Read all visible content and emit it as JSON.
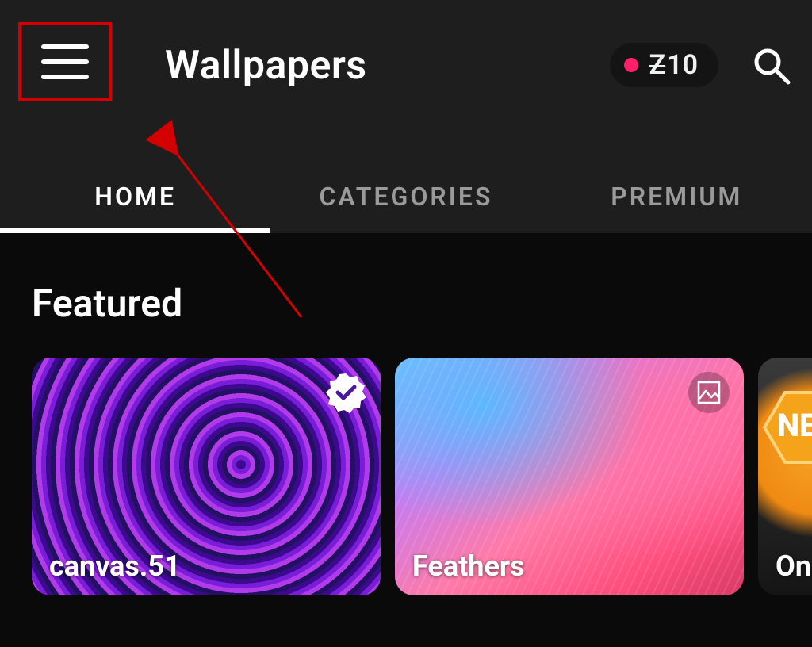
{
  "header": {
    "title": "Wallpapers",
    "coins": "10",
    "coins_prefix": "Z"
  },
  "tabs": [
    {
      "label": "HOME",
      "active": true
    },
    {
      "label": "CATEGORIES",
      "active": false
    },
    {
      "label": "PREMIUM",
      "active": false
    }
  ],
  "section": {
    "title": "Featured"
  },
  "cards": [
    {
      "label": "canvas.51",
      "badge": "verified"
    },
    {
      "label": "Feathers",
      "badge": "image"
    },
    {
      "label": "One",
      "badge_text": "NE"
    }
  ],
  "icons": {
    "menu": "hamburger-icon",
    "search": "search-icon",
    "verified": "verified-icon",
    "image": "image-icon"
  },
  "colors": {
    "highlight_box": "#d20000",
    "notification_dot": "#ff1f6d"
  }
}
